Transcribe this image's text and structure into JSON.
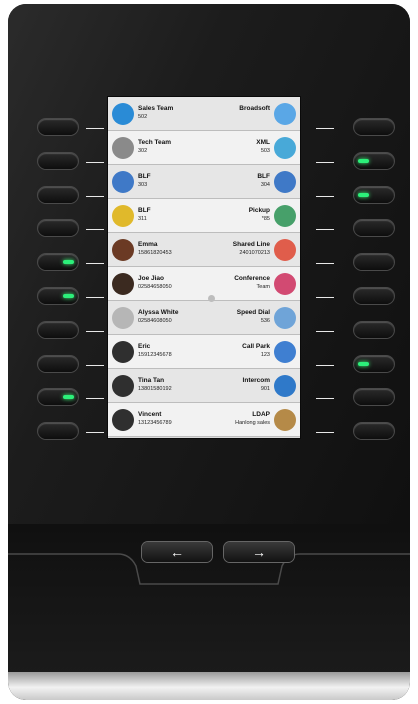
{
  "left_column": [
    {
      "title": "Sales Team",
      "sub": "502",
      "icon": "phone-icon",
      "color": "#2a8bd6"
    },
    {
      "title": "Tech Team",
      "sub": "302",
      "icon": "phone-icon",
      "color": "#8a8a8a"
    },
    {
      "title": "BLF",
      "sub": "303",
      "icon": "person-icon",
      "color": "#3f79c7"
    },
    {
      "title": "BLF",
      "sub": "311",
      "icon": "person-icon",
      "color": "#e0b92b"
    },
    {
      "title": "Emma",
      "sub": "15861820453",
      "icon": "avatar-icon",
      "color": "#6b3a24"
    },
    {
      "title": "Joe Jiao",
      "sub": "02584658050",
      "icon": "avatar-icon",
      "color": "#3b2a20"
    },
    {
      "title": "Alyssa White",
      "sub": "02584608050",
      "icon": "avatar-icon",
      "color": "#b6b6b6"
    },
    {
      "title": "Eric",
      "sub": "15912345678",
      "icon": "person-silhouette-icon",
      "color": "#2f2f2f"
    },
    {
      "title": "Tina Tan",
      "sub": "13801580192",
      "icon": "person-silhouette-icon",
      "color": "#2f2f2f"
    },
    {
      "title": "Vincent",
      "sub": "13123456789",
      "icon": "person-silhouette-icon",
      "color": "#2f2f2f"
    }
  ],
  "right_column": [
    {
      "title": "Broadsoft",
      "sub": "",
      "icon": "broadsoft-icon",
      "color": "#5aa7e6"
    },
    {
      "title": "XML",
      "sub": "503",
      "icon": "xml-icon",
      "color": "#48a9d8"
    },
    {
      "title": "BLF",
      "sub": "304",
      "icon": "person-icon",
      "color": "#3f79c7"
    },
    {
      "title": "Pickup",
      "sub": "*85",
      "icon": "pickup-icon",
      "color": "#47a06a"
    },
    {
      "title": "Shared Line",
      "sub": "2401070213",
      "icon": "shared-line-icon",
      "color": "#e05d4b"
    },
    {
      "title": "Conference",
      "sub": "Team",
      "icon": "conference-icon",
      "color": "#d24a72"
    },
    {
      "title": "Speed Dial",
      "sub": "536",
      "icon": "speed-dial-icon",
      "color": "#6fa4d8"
    },
    {
      "title": "Call Park",
      "sub": "123",
      "icon": "call-park-icon",
      "color": "#3f7fd1"
    },
    {
      "title": "Intercom",
      "sub": "901",
      "icon": "intercom-icon",
      "color": "#2f79c9"
    },
    {
      "title": "LDAP",
      "sub": "Hanlong sales",
      "icon": "ldap-icon",
      "color": "#b58a48"
    }
  ],
  "left_keys_led": [
    false,
    false,
    false,
    false,
    true,
    true,
    false,
    false,
    true,
    false
  ],
  "right_keys_led": [
    false,
    true,
    true,
    false,
    false,
    false,
    false,
    true,
    false,
    false
  ],
  "nav": {
    "prev": "←",
    "next": "→"
  },
  "colors": {
    "led": "#2cf07a",
    "screen_bg": "#d9d9d9"
  }
}
